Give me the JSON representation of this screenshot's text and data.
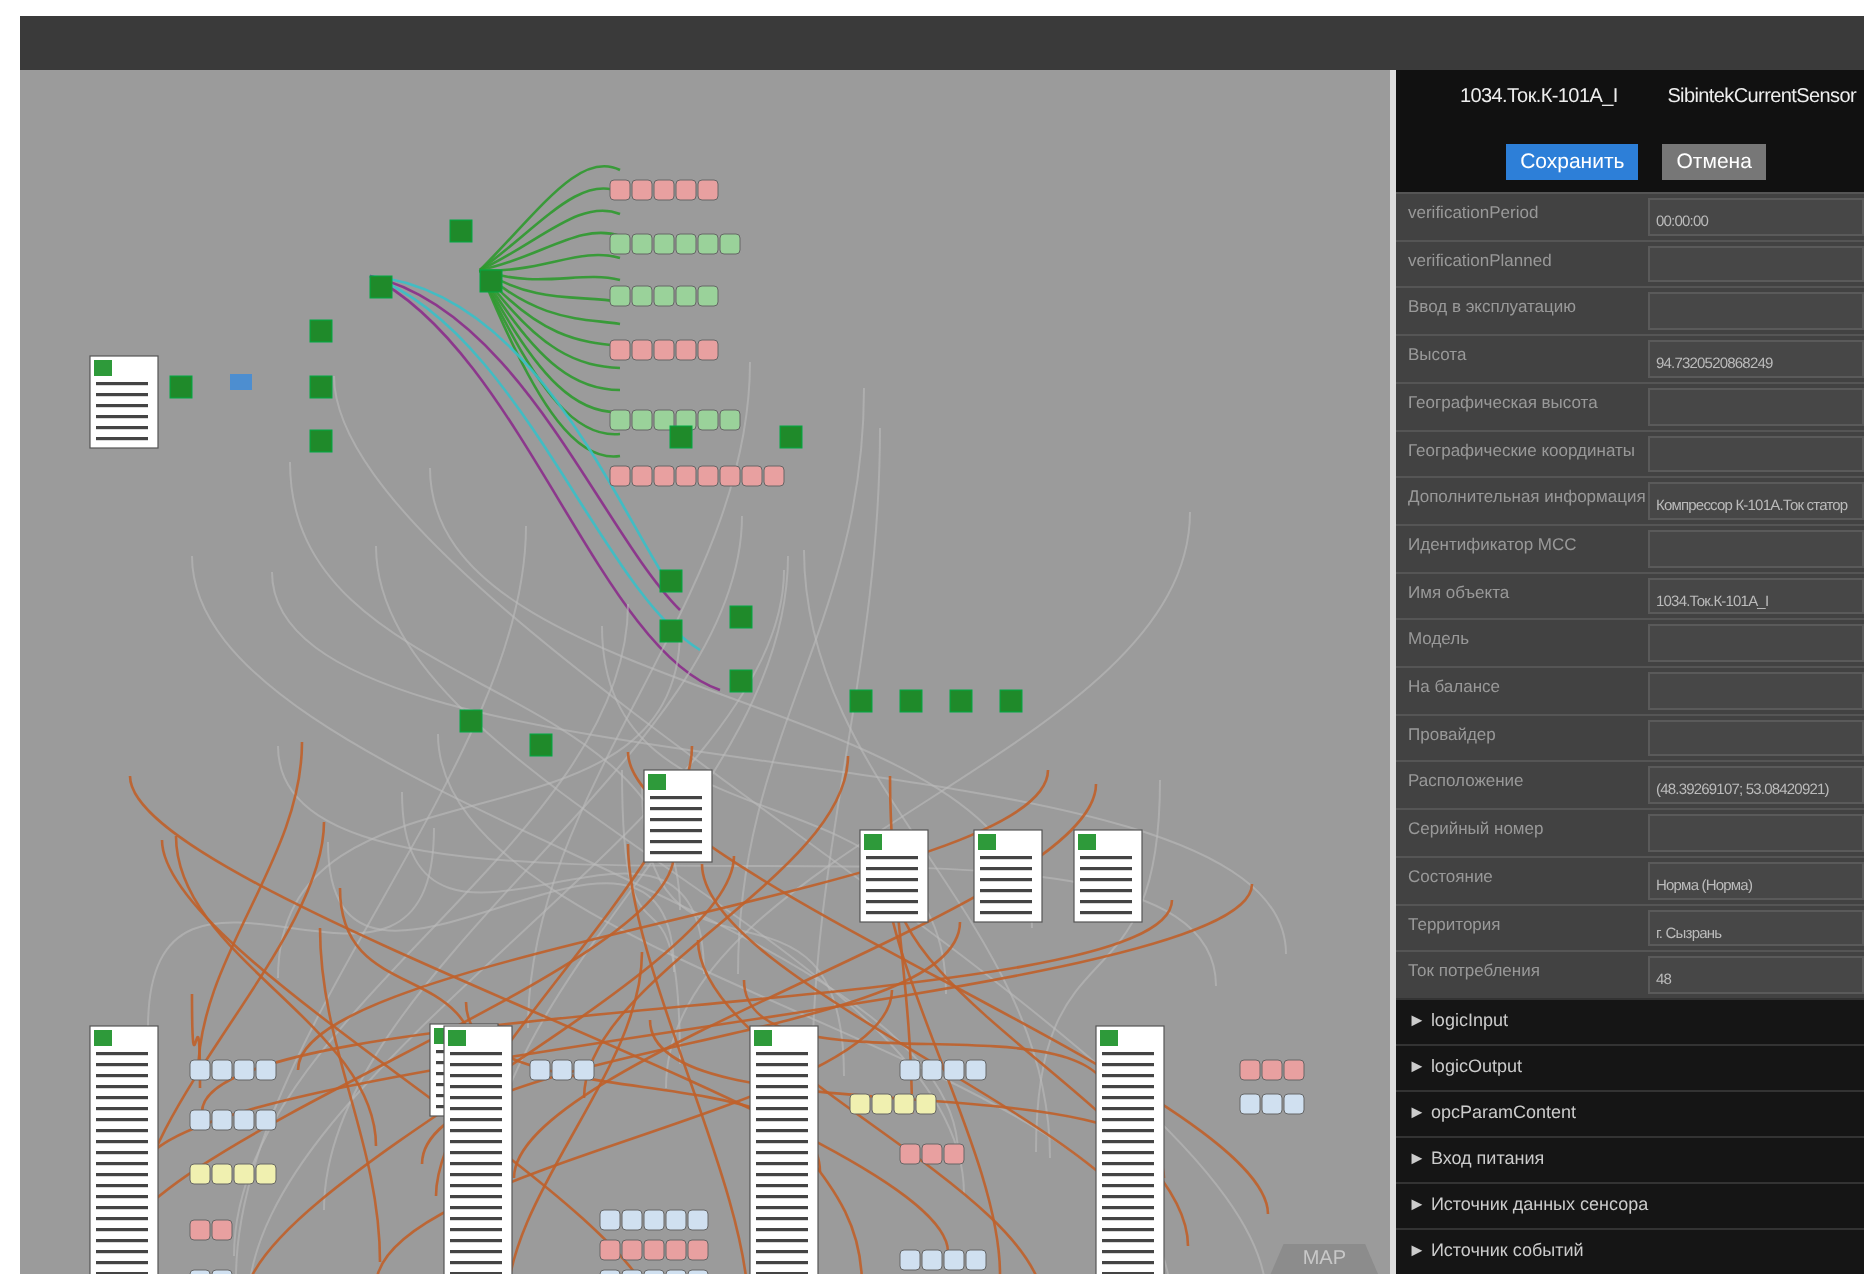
{
  "panel": {
    "object_name": "1034.Ток.К-101А_I",
    "object_type": "SibintekCurrentSensor",
    "buttons": [
      {
        "label": "Сохранить",
        "kind": "primary"
      },
      {
        "label": "Отмена",
        "kind": "secondary"
      }
    ],
    "properties": [
      {
        "label": "verificationPeriod",
        "value": "00:00:00"
      },
      {
        "label": "verificationPlanned"
      },
      {
        "label": "Ввод в эксплуатацию"
      },
      {
        "label": "Высота",
        "value": "94.7320520868249"
      },
      {
        "label": "Географическая высота"
      },
      {
        "label": "Географические координаты"
      },
      {
        "label": "Дополнительная информация",
        "value": "Компрессор К-101А.Ток статор"
      },
      {
        "label": "Идентификатор МСС"
      },
      {
        "label": "Имя объекта",
        "value": "1034.Ток.К-101А_I"
      },
      {
        "label": "Модель"
      },
      {
        "label": "На балансе"
      },
      {
        "label": "Провайдер"
      },
      {
        "label": "Расположение",
        "value": "(48.39269107; 53.08420921)"
      },
      {
        "label": "Серийный номер"
      },
      {
        "label": "Состояние",
        "value": "Норма (Норма)"
      },
      {
        "label": "Территория",
        "value": "г. Сызрань"
      },
      {
        "label": "Ток потребления",
        "value": "48"
      }
    ],
    "sections": [
      {
        "marker": "►",
        "label": "logicInput",
        "expanded": false
      },
      {
        "marker": "►",
        "label": "logicOutput",
        "expanded": false
      },
      {
        "marker": "►",
        "label": "opcParamContent",
        "expanded": false
      },
      {
        "marker": "►",
        "label": "Вход питания",
        "expanded": false
      },
      {
        "marker": "►",
        "label": "Источник данных сенсора",
        "expanded": false
      },
      {
        "marker": "►",
        "label": "Источник событий",
        "expanded": false
      }
    ]
  },
  "canvas": {
    "map_tab": "MAP"
  }
}
